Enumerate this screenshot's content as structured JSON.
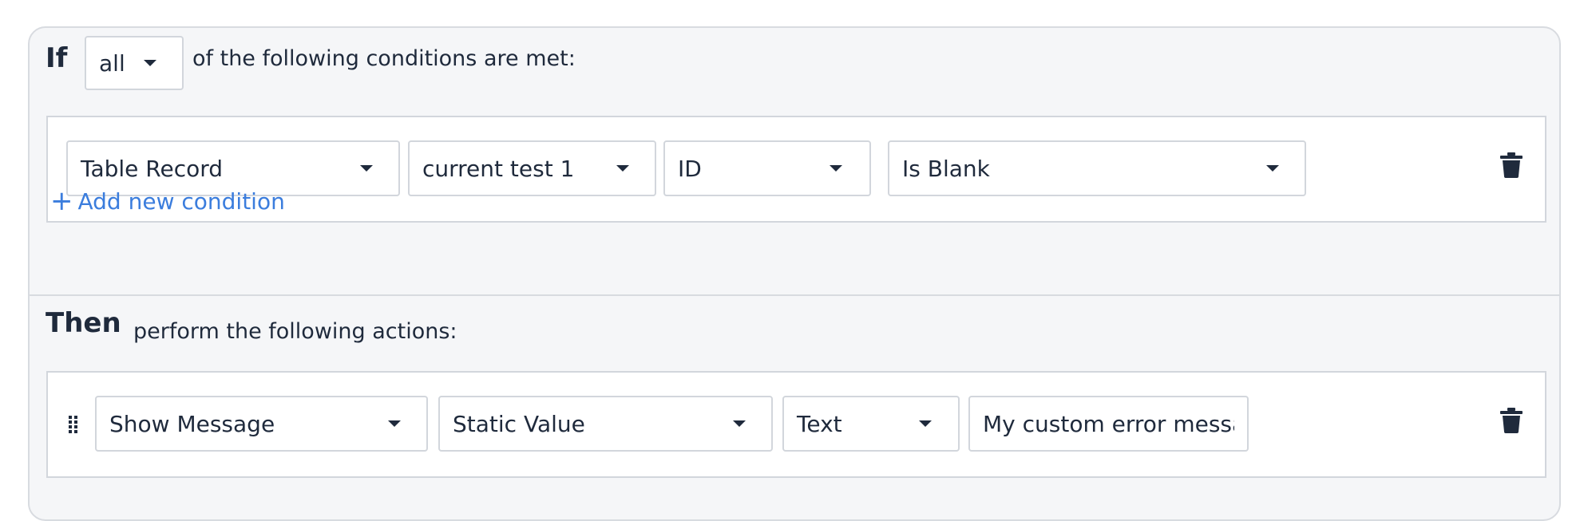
{
  "if_section": {
    "keyword": "If",
    "match_select": "all",
    "suffix": "of the following conditions are met:"
  },
  "condition": {
    "field_1": "Table Record",
    "field_2": "current test 1",
    "field_3": "ID",
    "operator": "Is Blank"
  },
  "add_condition": {
    "plus": "+",
    "label": "Add new condition"
  },
  "then_section": {
    "keyword": "Then",
    "suffix": "perform the following actions:"
  },
  "action": {
    "type": "Show Message",
    "source": "Static Value",
    "format": "Text",
    "value": "My custom error message"
  },
  "icons": {
    "delete": "trash-icon",
    "drag": "drag-handle-icon",
    "dropdown": "caret-down-icon"
  },
  "colors": {
    "panel_bg": "#f5f6f8",
    "text": "#1f2a3c",
    "link": "#3b7ddd",
    "border": "#d2d6dc"
  }
}
